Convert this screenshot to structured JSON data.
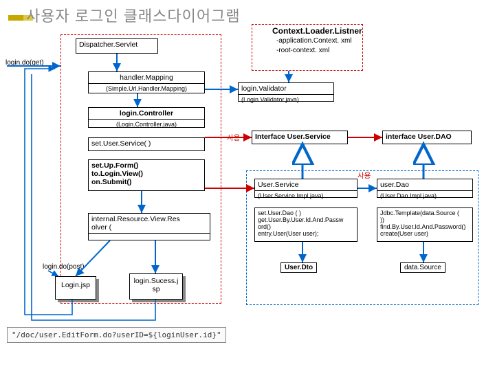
{
  "title": "사용자 로그인 클래스다이어그램",
  "servlet": "Dispatcher.Servlet",
  "getLabel": "login.do(get)",
  "postLabel": "login.do(post)",
  "handlerMapping": {
    "name": "handler.Mapping",
    "detail": "(Simple.Url.Handler.Mapping)"
  },
  "controller": {
    "name": "login.Controller",
    "detail": "(Login.Controller.java)",
    "m1": "set.User.Service( )",
    "m2": "set.Up.Form()\nto.Login.View()\non.Submit()"
  },
  "resolver": "internal.Resource.View.Res\nolver (",
  "loginJsp": "Login.jsp",
  "successJsp": "login.Sucess.j\nsp",
  "context": {
    "title": "Context.Loader.Listner",
    "l1": "-application.Context. xml",
    "l2": "-root-context. xml"
  },
  "validator": {
    "name": "login.Validator",
    "detail": "(Login.Validator.java)"
  },
  "iface": {
    "title": "Interface User.Service",
    "right": "interface User.DAO"
  },
  "userService": {
    "name": "User.Service",
    "detail": "(User.Service.Impl.java)",
    "methods": "set.User.Dao ( )\nget.User.By.User.Id.And.Passw\nord()\nentry.User(User user);"
  },
  "userDao": {
    "name": "user.Dao",
    "detail": "(User.Dao.Impl.java)",
    "methods": "Jdbc.Template(data.Source (\n))\nfind.By.User.Id.And.Password()\ncreate(User user)"
  },
  "dto": "User.Dto",
  "ds": "data.Source",
  "use": "사용",
  "snippet": "\"/doc/user.EditForm.do?userID=${loginUser.id}\""
}
